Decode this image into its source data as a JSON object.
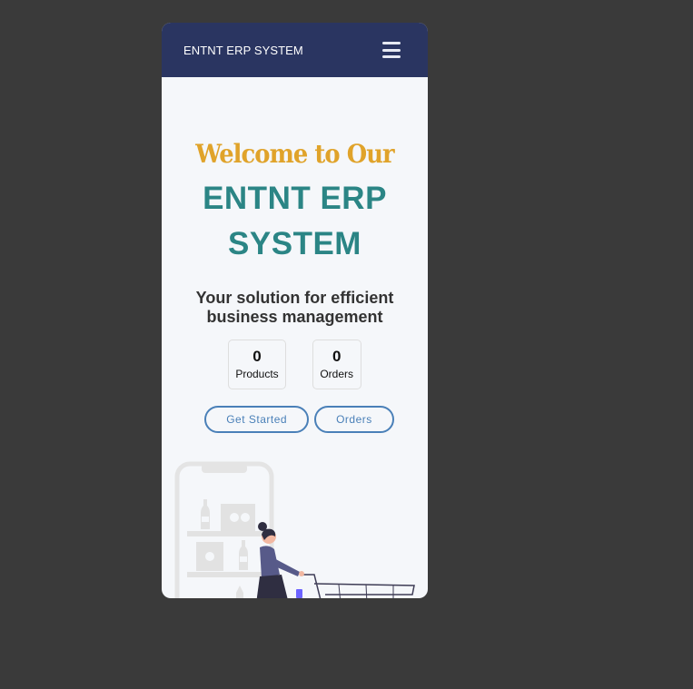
{
  "navbar": {
    "brand": "ENTNT ERP SYSTEM",
    "menu_icon": "hamburger-menu-icon"
  },
  "hero": {
    "welcome": "Welcome to Our",
    "title_line1": "ENTNT ERP",
    "title_line2": "SYSTEM",
    "subtitle": "Your solution for efficient business management"
  },
  "stats": [
    {
      "value": "0",
      "label": "Products"
    },
    {
      "value": "0",
      "label": "Orders"
    }
  ],
  "buttons": {
    "get_started": "Get Started",
    "orders": "Orders"
  },
  "illustration": {
    "name": "shopping-illustration"
  },
  "colors": {
    "navbar_bg": "#2a3561",
    "welcome": "#e0a32a",
    "title": "#2b8585",
    "button": "#4a80b8",
    "page_bg": "#3a3a3a"
  }
}
